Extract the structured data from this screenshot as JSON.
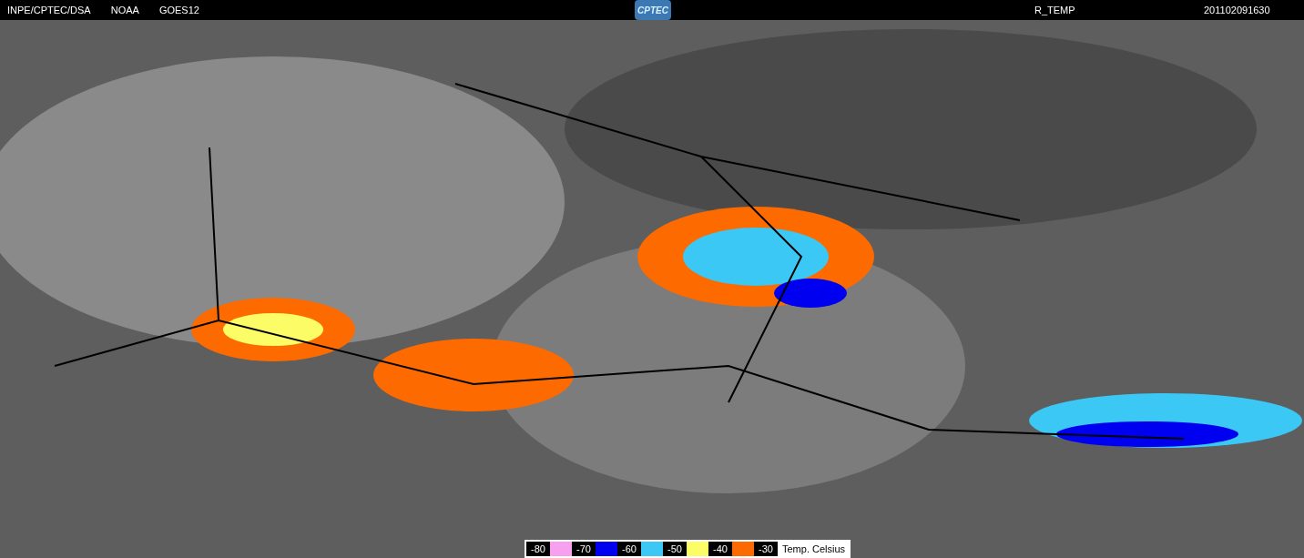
{
  "header": {
    "sources": [
      "INPE/CPTEC/DSA",
      "NOAA",
      "GOES12"
    ],
    "logo": "CPTEC",
    "product": "R_TEMP",
    "timestamp": "201102091630"
  },
  "legend": {
    "items": [
      {
        "label": "-80",
        "color": "#f7a0ef"
      },
      {
        "label": "-70",
        "color": "#0000f0"
      },
      {
        "label": "-60",
        "color": "#3cc8f4"
      },
      {
        "label": "-50",
        "color": "#fcfc66"
      },
      {
        "label": "-40",
        "color": "#fc6a00"
      },
      {
        "label": "-30"
      }
    ],
    "title": "Temp. Celsius"
  }
}
